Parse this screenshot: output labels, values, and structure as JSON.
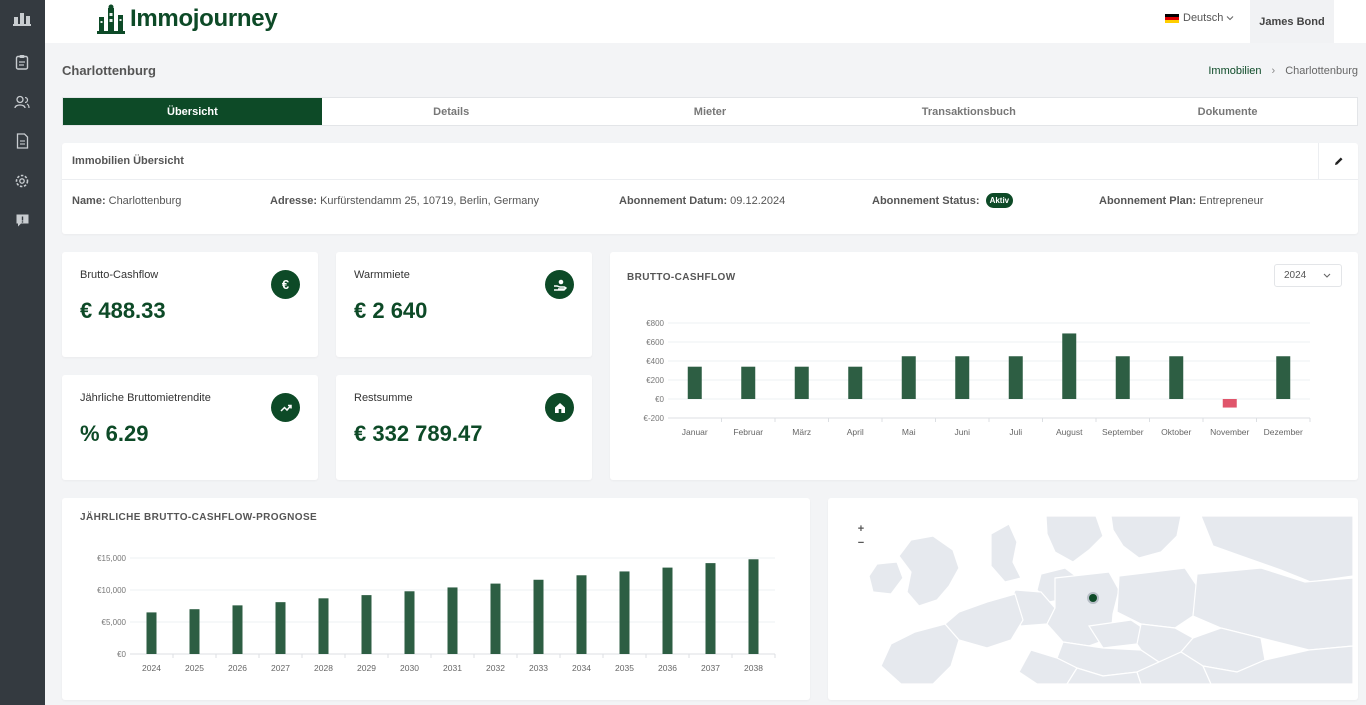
{
  "app": {
    "brand": "Immojourney",
    "language": "Deutsch",
    "user": "James Bond"
  },
  "sidebar": {
    "icons": [
      "building-icon",
      "clipboard-icon",
      "users-icon",
      "document-icon",
      "settings-icon",
      "support-icon"
    ]
  },
  "page": {
    "title": "Charlottenburg"
  },
  "breadcrumb": {
    "parent": "Immobilien",
    "separator": "›",
    "current": "Charlottenburg"
  },
  "tabs": [
    {
      "label": "Übersicht",
      "active": true
    },
    {
      "label": "Details",
      "active": false
    },
    {
      "label": "Mieter",
      "active": false
    },
    {
      "label": "Transaktionsbuch",
      "active": false
    },
    {
      "label": "Dokumente",
      "active": false
    }
  ],
  "overview": {
    "title": "Immobilien Übersicht",
    "name_label": "Name:",
    "name": "Charlottenburg",
    "address_label": "Adresse:",
    "address": "Kurfürstendamm 25, 10719, Berlin, Germany",
    "sub_date_label": "Abonnement Datum:",
    "sub_date": "09.12.2024",
    "sub_status_label": "Abonnement Status:",
    "sub_status": "Aktiv",
    "sub_plan_label": "Abonnement Plan:",
    "sub_plan": "Entrepreneur"
  },
  "kpis": [
    {
      "label": "Brutto-Cashflow",
      "value": "€ 488.33",
      "icon": "euro-icon"
    },
    {
      "label": "Warmmiete",
      "value": "€ 2 640",
      "icon": "rent-hand-icon"
    },
    {
      "label": "Jährliche Bruttomietrendite",
      "value": "% 6.29",
      "icon": "trend-icon"
    },
    {
      "label": "Restsumme",
      "value": "€ 332 789.47",
      "icon": "home-icon"
    }
  ],
  "cashflow_chart": {
    "title": "BRUTTO-CASHFLOW",
    "year": "2024"
  },
  "forecast_chart": {
    "title": "JÄHRLICHE BRUTTO-CASHFLOW-PROGNOSE"
  },
  "map": {
    "zoom_in": "+",
    "zoom_out": "−",
    "marker": "Berlin"
  },
  "colors": {
    "primary": "#0d4a27",
    "bar": "#2d5e43",
    "negative": "#e0556b",
    "sidebar": "#343a40"
  },
  "chart_data": [
    {
      "type": "bar",
      "title": "BRUTTO-CASHFLOW",
      "categories": [
        "Januar",
        "Februar",
        "März",
        "April",
        "Mai",
        "Juni",
        "Juli",
        "August",
        "September",
        "Oktober",
        "November",
        "Dezember"
      ],
      "values": [
        340,
        340,
        340,
        340,
        450,
        450,
        450,
        690,
        450,
        450,
        -90,
        450
      ],
      "yticks": [
        "€-200",
        "€0",
        "€200",
        "€400",
        "€600",
        "€800"
      ],
      "ylim": [
        -200,
        800
      ],
      "grid": true
    },
    {
      "type": "bar",
      "title": "JÄHRLICHE BRUTTO-CASHFLOW-PROGNOSE",
      "categories": [
        "2024",
        "2025",
        "2026",
        "2027",
        "2028",
        "2029",
        "2030",
        "2031",
        "2032",
        "2033",
        "2034",
        "2035",
        "2036",
        "2037",
        "2038"
      ],
      "values": [
        6500,
        7000,
        7600,
        8100,
        8700,
        9200,
        9800,
        10400,
        11000,
        11600,
        12300,
        12900,
        13500,
        14200,
        14800
      ],
      "yticks": [
        "€0",
        "€5,000",
        "€10,000",
        "€15,000"
      ],
      "ylim": [
        0,
        15000
      ],
      "grid": true
    }
  ]
}
